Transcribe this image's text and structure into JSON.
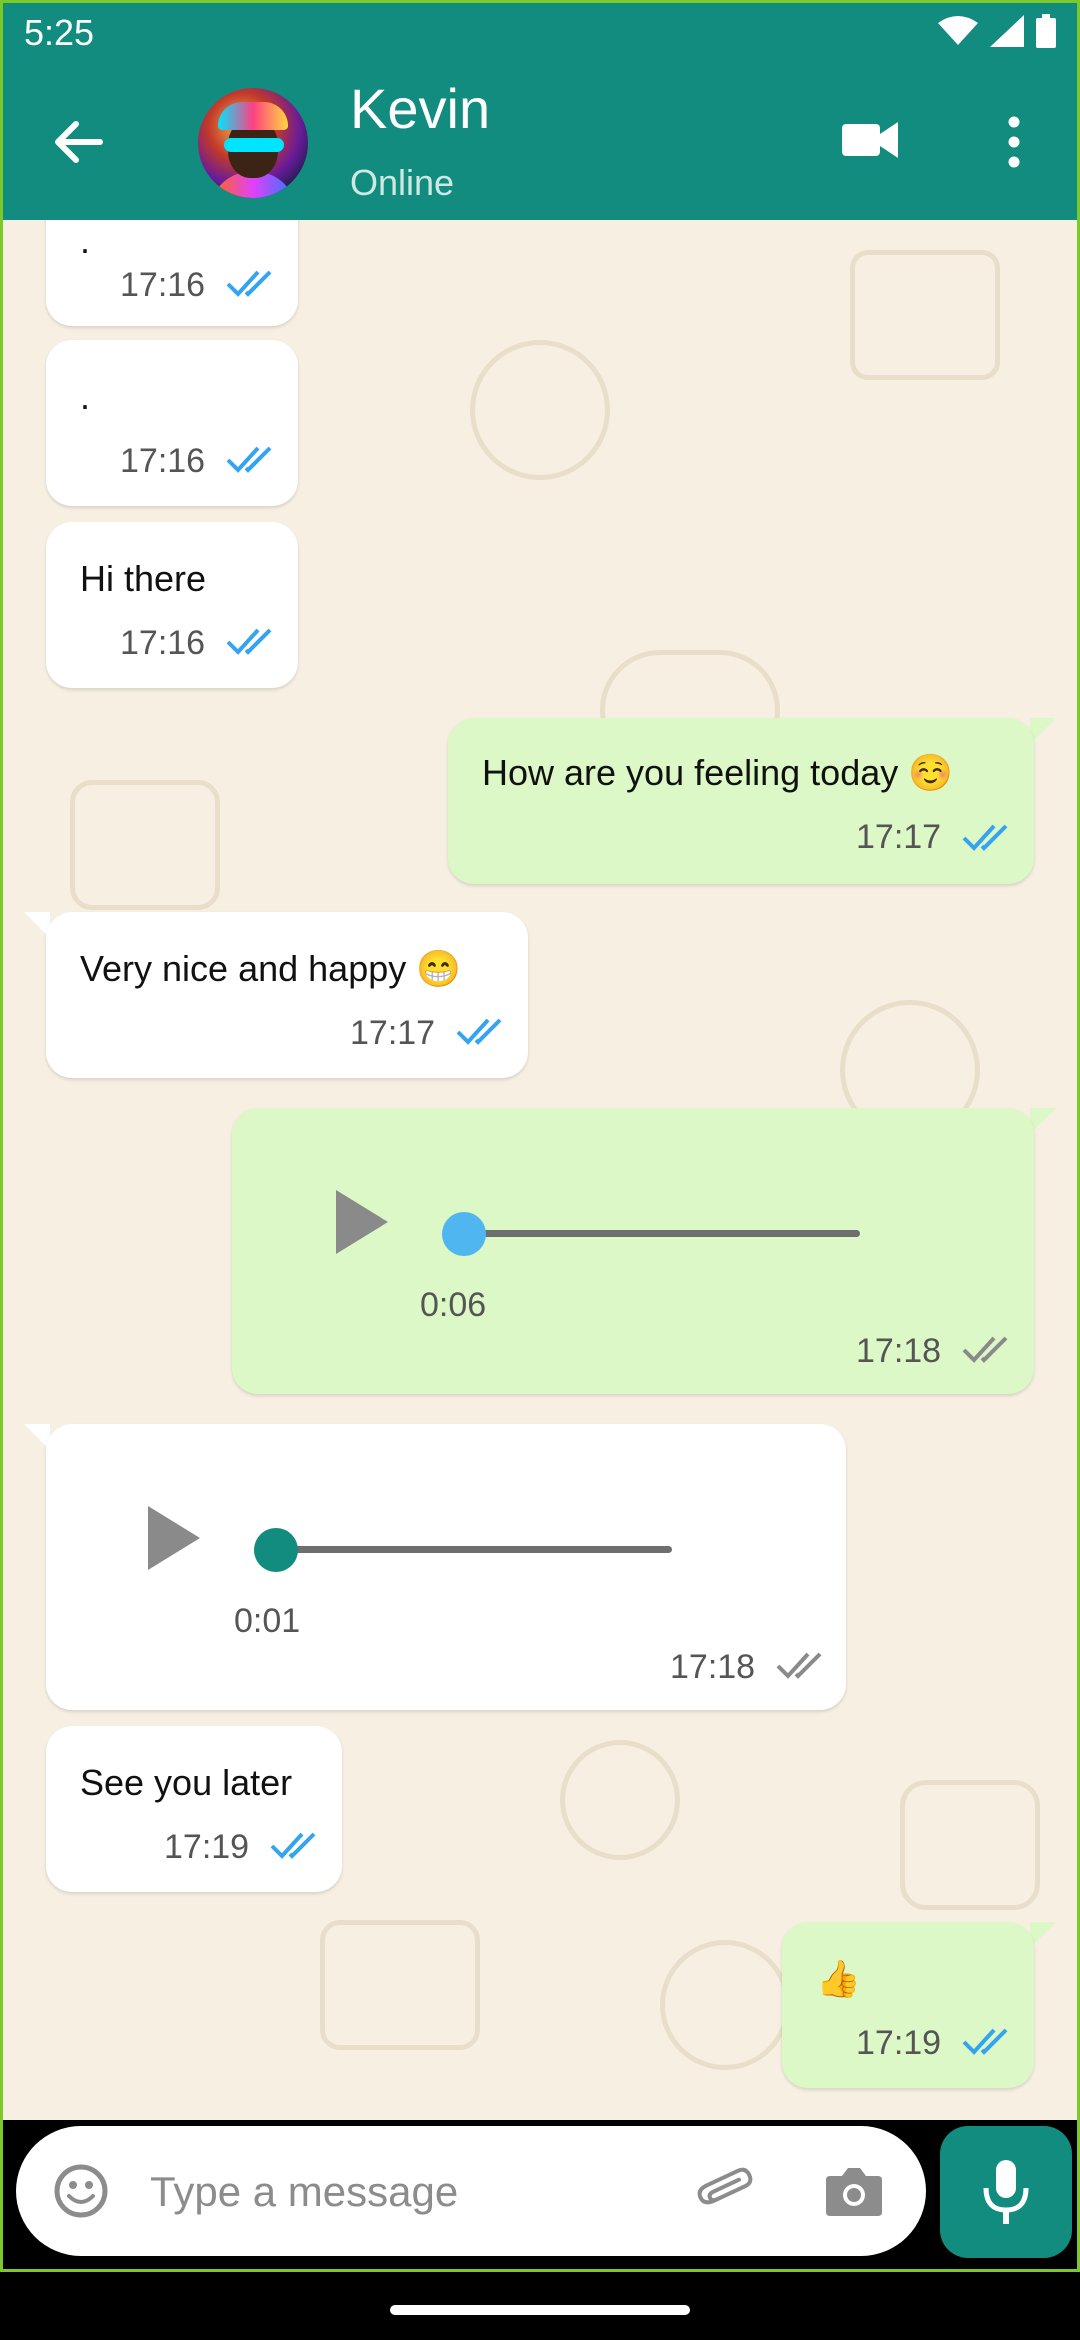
{
  "status_bar": {
    "time": "5:25"
  },
  "header": {
    "contact_name": "Kevin",
    "contact_status": "Online"
  },
  "messages": [
    {
      "dir": "in",
      "text": ".",
      "time": "17:16",
      "ticks": "read"
    },
    {
      "dir": "in",
      "text": ".",
      "time": "17:16",
      "ticks": "read"
    },
    {
      "dir": "in",
      "text": "Hi there",
      "time": "17:16",
      "ticks": "read"
    },
    {
      "dir": "out",
      "text": "How are you feeling today ☺️",
      "time": "17:17",
      "ticks": "read"
    },
    {
      "dir": "in",
      "text": "Very nice and happy 😁",
      "time": "17:17",
      "ticks": "read"
    },
    {
      "dir": "out",
      "type": "voice",
      "duration": "0:06",
      "time": "17:18",
      "ticks": "delivered",
      "progress": 0
    },
    {
      "dir": "in",
      "type": "voice",
      "duration": "0:01",
      "time": "17:18",
      "ticks": "delivered",
      "progress": 0
    },
    {
      "dir": "in",
      "text": "See you later",
      "time": "17:19",
      "ticks": "read"
    },
    {
      "dir": "out",
      "text": "👍",
      "time": "17:19",
      "ticks": "read"
    }
  ],
  "composer": {
    "placeholder": "Type a message"
  },
  "colors": {
    "header": "#128c7e",
    "outgoing_bubble": "#dcf8c6",
    "incoming_bubble": "#ffffff",
    "read_tick": "#34a4f0",
    "delivered_tick": "#8a8a8a",
    "voice_knob_out": "#4fb6f0",
    "voice_knob_in": "#128c7e"
  },
  "icons": [
    "back-arrow-icon",
    "video-call-icon",
    "more-vert-icon",
    "emoji-icon",
    "attach-icon",
    "camera-icon",
    "mic-icon",
    "play-icon",
    "double-check-icon",
    "wifi-icon",
    "signal-icon",
    "battery-icon"
  ]
}
